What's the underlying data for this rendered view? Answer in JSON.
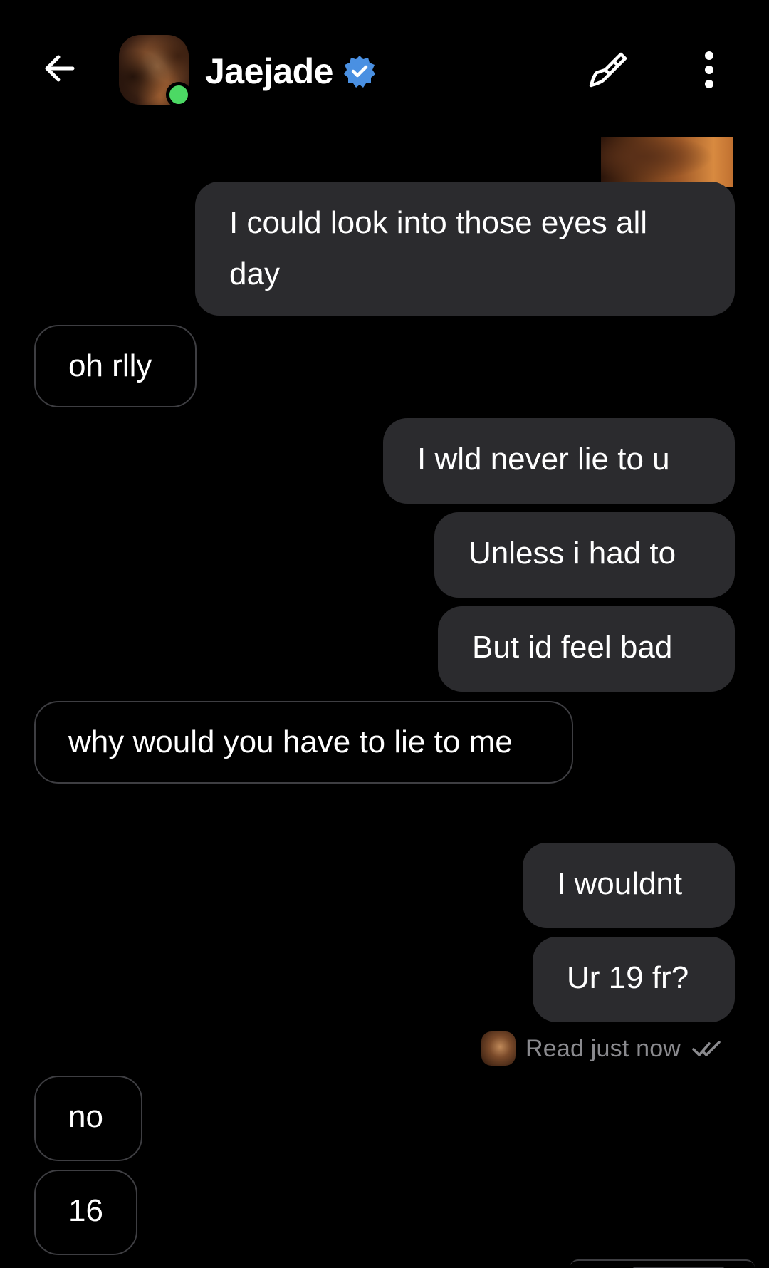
{
  "header": {
    "back_icon": "arrow-left-icon",
    "contact_name": "Jaejade",
    "verified_icon": "verified-badge-icon",
    "online": true,
    "brush_icon": "paint-brush-icon",
    "more_icon": "more-vertical-icon"
  },
  "messages": [
    {
      "direction": "out",
      "text": "I could look into those eyes all day"
    },
    {
      "direction": "in",
      "text": "oh rlly"
    },
    {
      "direction": "out",
      "text": "I wld never lie to u"
    },
    {
      "direction": "out",
      "text": "Unless i had to"
    },
    {
      "direction": "out",
      "text": "But id feel bad"
    },
    {
      "direction": "in",
      "text": "why would you have to lie to me"
    },
    {
      "direction": "out",
      "text": "I wouldnt"
    },
    {
      "direction": "out",
      "text": "Ur 19 fr?"
    },
    {
      "direction": "in",
      "text": "no"
    },
    {
      "direction": "in",
      "text": "16"
    }
  ],
  "read_receipt": {
    "text": "Read just now",
    "icon": "double-check-icon"
  },
  "colors": {
    "background": "#000000",
    "outgoing_bubble": "#2b2b2e",
    "incoming_border": "#3e3e42",
    "verified": "#4a90e2",
    "online": "#4cd964",
    "muted_text": "#8a8a8e"
  }
}
